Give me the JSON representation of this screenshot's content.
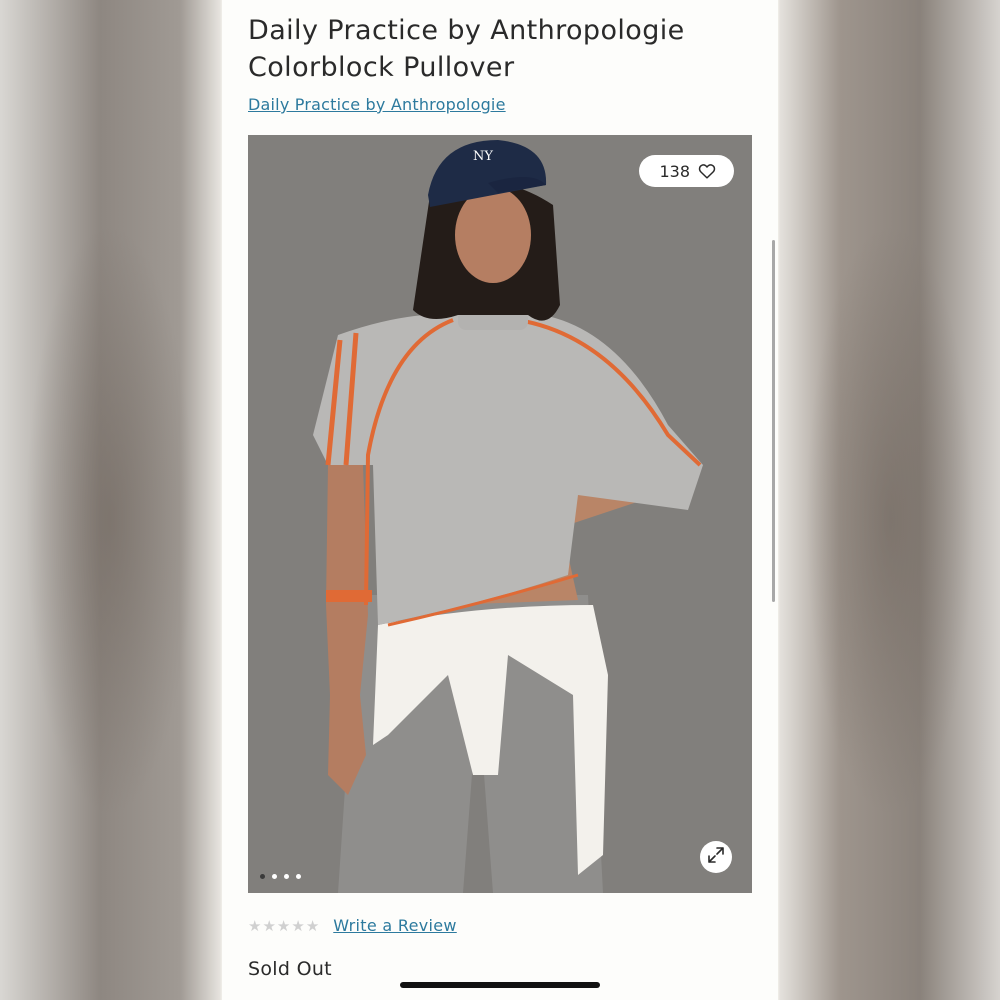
{
  "product": {
    "title_line1": "Daily Practice by Anthropologie",
    "title_line2": "Colorblock Pullover",
    "brand_link": "Daily Practice by Anthropologie"
  },
  "gallery": {
    "like_count": "138",
    "image_count": 4,
    "active_index": 0,
    "icons": {
      "like": "heart-icon",
      "expand": "expand-icon"
    }
  },
  "reviews": {
    "rating": 0,
    "max_rating": 5,
    "write_review_label": "Write a Review"
  },
  "availability": {
    "status": "Sold Out"
  },
  "colors": {
    "link": "#2d7a9e",
    "text": "#2a2a2a",
    "page_bg": "#fdfdfb",
    "star_empty": "#d0d0d0"
  }
}
